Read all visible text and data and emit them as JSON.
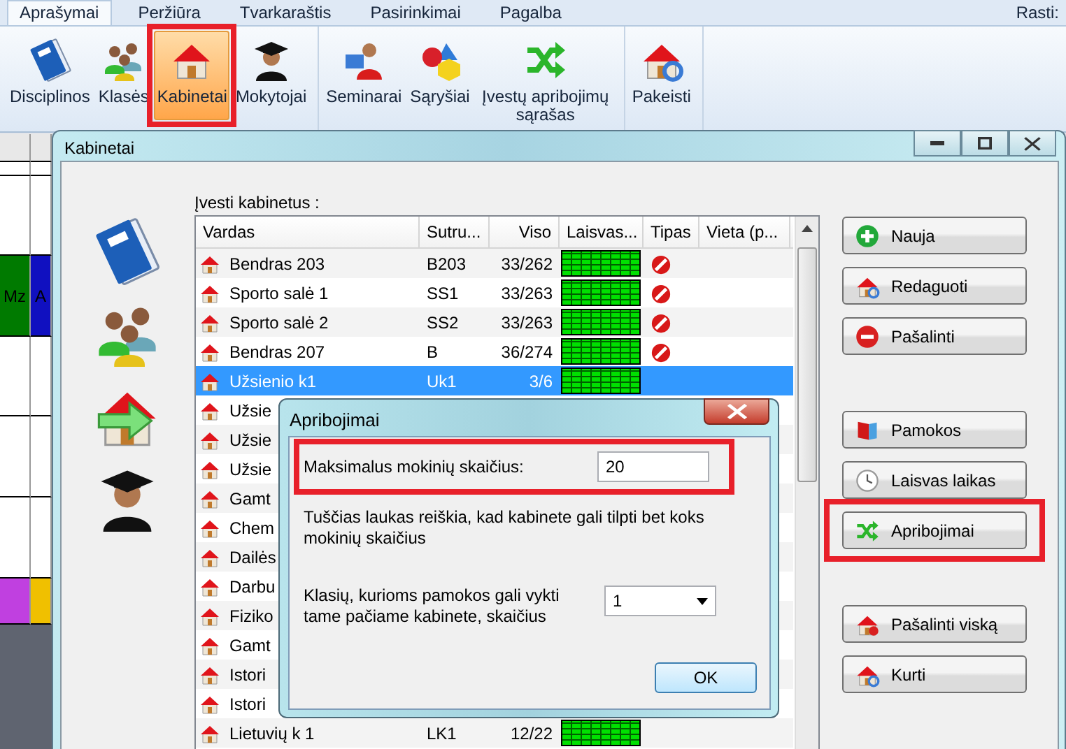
{
  "ribbon": {
    "tabs": [
      {
        "label": "Aprašymai",
        "selected": true
      },
      {
        "label": "Peržiūra",
        "selected": false
      },
      {
        "label": "Tvarkaraštis",
        "selected": false
      },
      {
        "label": "Pasirinkimai",
        "selected": false
      },
      {
        "label": "Pagalba",
        "selected": false
      }
    ],
    "search_label": "Rasti:",
    "groups": [
      {
        "items": [
          {
            "label": "Disciplinos",
            "selected": false,
            "highlighted": false
          },
          {
            "label": "Klasės",
            "selected": false,
            "highlighted": false
          },
          {
            "label": "Kabinetai",
            "selected": true,
            "highlighted": true
          },
          {
            "label": "Mokytojai",
            "selected": false,
            "highlighted": false
          }
        ]
      },
      {
        "items": [
          {
            "label": "Seminarai",
            "selected": false,
            "highlighted": false
          },
          {
            "label": "Sąryšiai",
            "selected": false,
            "highlighted": false
          },
          {
            "label": "Įvestų apribojimų sąrašas",
            "selected": false,
            "highlighted": false
          }
        ]
      },
      {
        "items": [
          {
            "label": "Pakeisti",
            "selected": false,
            "highlighted": false
          }
        ]
      }
    ]
  },
  "background": {
    "cells": [
      {
        "text": "Mz",
        "color": "#007a00"
      },
      {
        "text": "A",
        "color": "#1010c0"
      }
    ]
  },
  "window": {
    "title": "Kabinetai",
    "list_label": "Įvesti kabinetus :",
    "columns": [
      "Vardas",
      "Sutru...",
      "Viso",
      "Laisvas...",
      "Tipas",
      "Vieta (p..."
    ],
    "rows": [
      {
        "name": "Bendras 203",
        "group": "B203",
        "total": "33/262",
        "blocked": true,
        "selected": false
      },
      {
        "name": "Sporto salė 1",
        "group": "SS1",
        "total": "33/263",
        "blocked": true,
        "selected": false
      },
      {
        "name": "Sporto salė 2",
        "group": "SS2",
        "total": "33/263",
        "blocked": true,
        "selected": false
      },
      {
        "name": "Bendras 207",
        "group": "B",
        "total": "36/274",
        "blocked": true,
        "selected": false
      },
      {
        "name": "Užsienio k1",
        "group": "Uk1",
        "total": "3/6",
        "blocked": false,
        "selected": true
      },
      {
        "name": "Užsie",
        "selected": false
      },
      {
        "name": "Užsie",
        "selected": false
      },
      {
        "name": "Užsie",
        "selected": false
      },
      {
        "name": "Gamt",
        "selected": false
      },
      {
        "name": "Chem",
        "selected": false
      },
      {
        "name": "Dailės",
        "selected": false
      },
      {
        "name": "Darbu",
        "selected": false
      },
      {
        "name": "Fiziko",
        "selected": false
      },
      {
        "name": "Gamt",
        "selected": false
      },
      {
        "name": "Istori",
        "selected": false
      },
      {
        "name": "Istori",
        "selected": false
      },
      {
        "name": "Lietuvių k 1",
        "group": "LK1",
        "total": "12/22",
        "blocked": false,
        "selected": false
      }
    ],
    "button_groups": [
      [
        {
          "label": "Nauja",
          "highlighted": false
        },
        {
          "label": "Redaguoti",
          "highlighted": false
        },
        {
          "label": "Pašalinti",
          "highlighted": false
        }
      ],
      [
        {
          "label": "Pamokos",
          "highlighted": false
        },
        {
          "label": "Laisvas laikas",
          "highlighted": false
        },
        {
          "label": "Apribojimai",
          "highlighted": true
        }
      ],
      [
        {
          "label": "Pašalinti viską",
          "highlighted": false
        },
        {
          "label": "Kurti",
          "highlighted": false
        }
      ]
    ]
  },
  "dialog": {
    "title": "Apribojimai",
    "max_students": {
      "label": "Maksimalus mokinių skaičius:",
      "value": "20",
      "highlighted": true
    },
    "note": "Tuščias laukas reiškia, kad kabinete gali tilpti bet koks mokinių skaičius",
    "classes": {
      "label": "Klasių, kurioms pamokos gali vykti tame pačiame kabinete, skaičius",
      "value": "1"
    },
    "ok": "OK"
  }
}
